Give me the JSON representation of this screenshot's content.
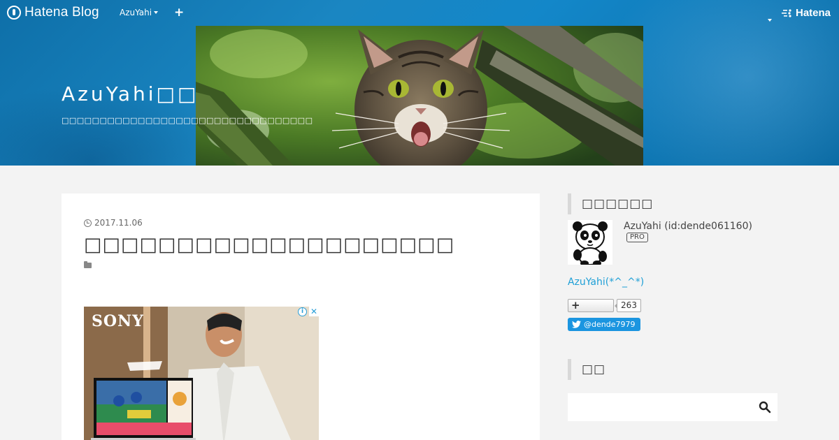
{
  "topbar": {
    "logo_text": "Hatena Blog",
    "user_label": "AzuYahi",
    "add_label": "+",
    "hatena_label": "Hatena"
  },
  "blog": {
    "title": "AzuYahi□□",
    "description": "□□□□□□□□□□□□□□□□□□□□□□□□□□□□□□□□□"
  },
  "entry": {
    "date": "2017.11.06",
    "title": "□□□□□□□□□□□□□□□□□□□□"
  },
  "ad": {
    "brand": "SONY",
    "info_label": "i",
    "close_label": "✕"
  },
  "sidebar": {
    "profile_heading": "□□□□□□",
    "profile_name": "AzuYahi (id:dende061160)",
    "pro_badge": "PRO",
    "profile_link": "AzuYahi(*^_^*)",
    "follow_label": "+",
    "follow_count": "263",
    "twitter_label": "@dende7979",
    "search_heading": "□□",
    "search_placeholder": ""
  },
  "colors": {
    "header_blue": "#1387c9",
    "link_blue": "#1e9fd6",
    "twitter_blue": "#1b95e0"
  }
}
